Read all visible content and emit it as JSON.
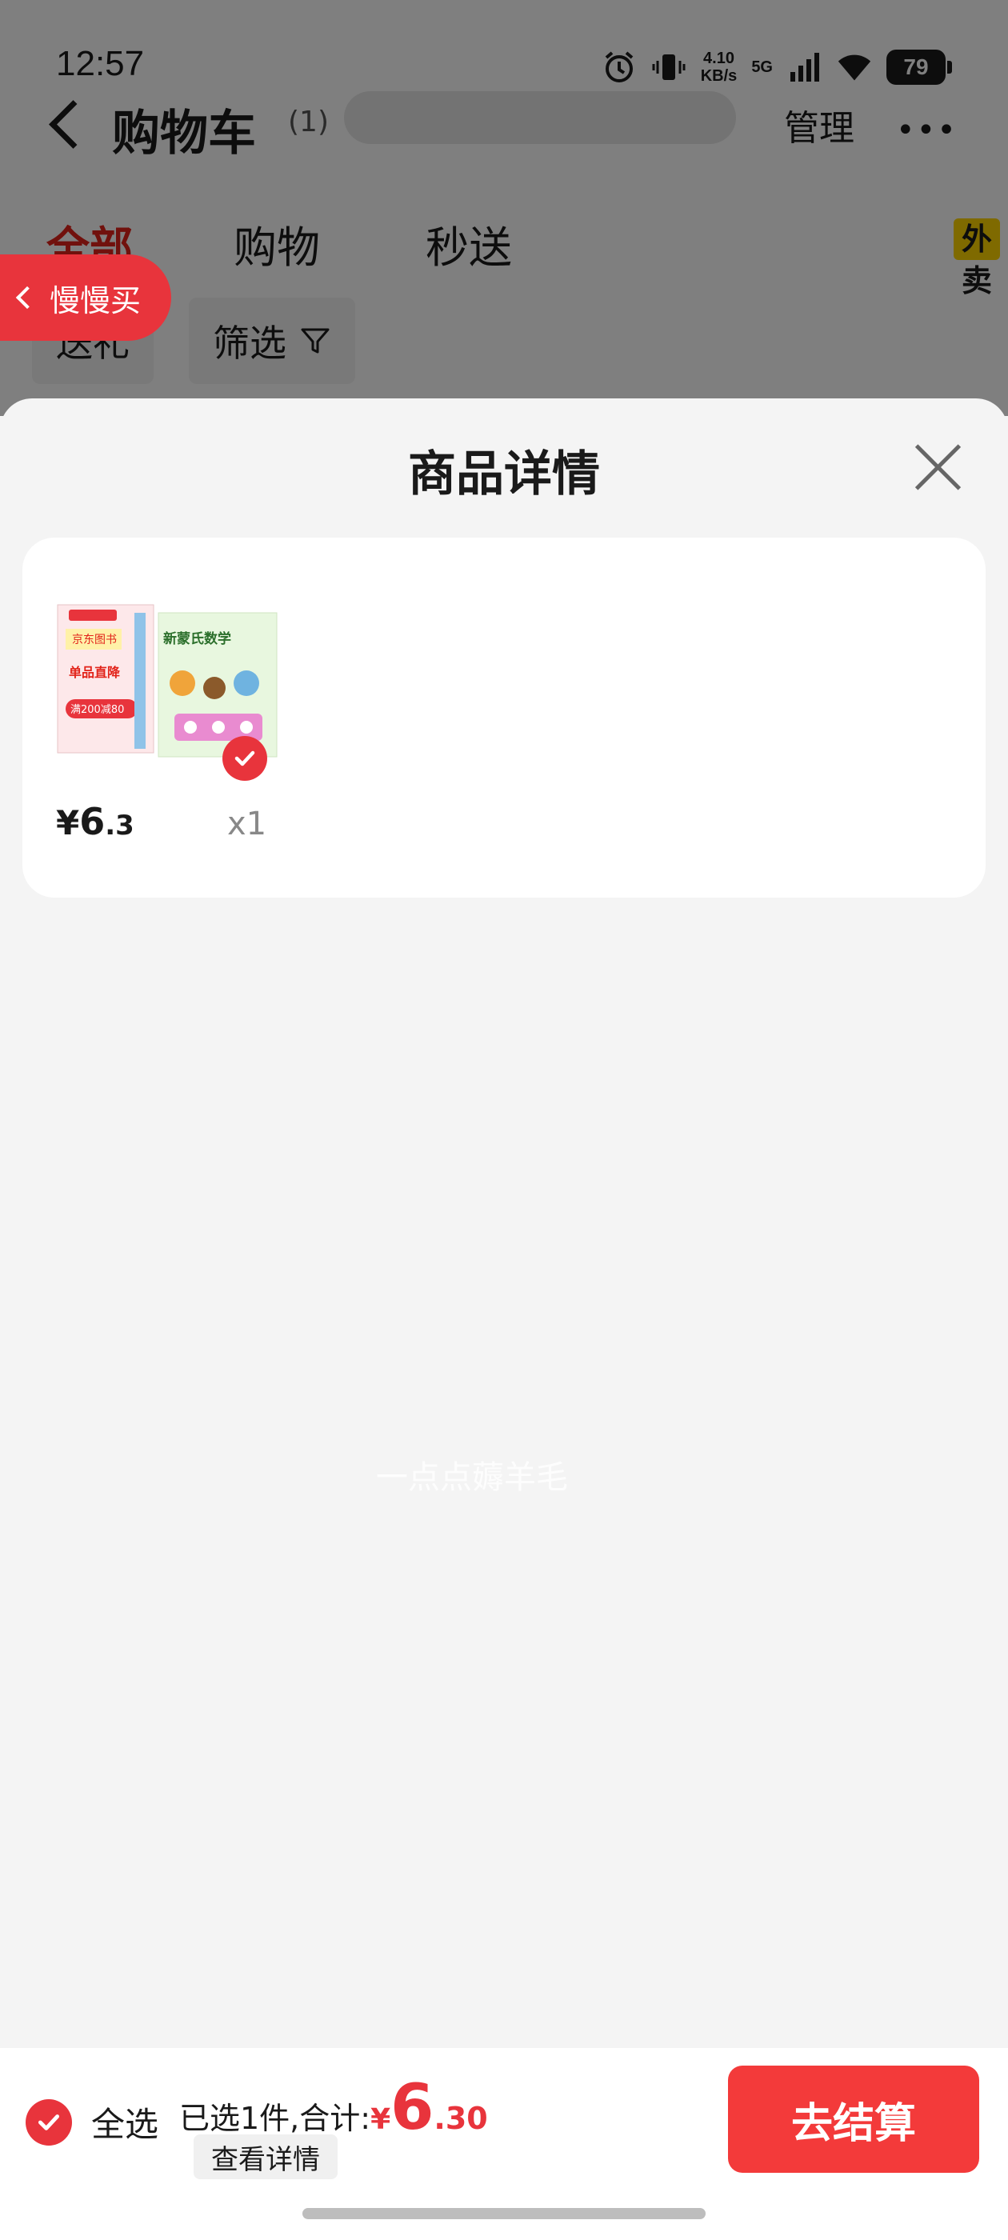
{
  "status_bar": {
    "time": "12:57",
    "net_speed_value": "4.10",
    "net_speed_unit": "KB/s",
    "network": "5G",
    "battery": "79",
    "icons": [
      "alarm-icon",
      "vibrate-icon",
      "signal-icon",
      "wifi-icon",
      "battery-icon"
    ]
  },
  "background_page": {
    "title": "购物车",
    "count": "(1)",
    "manage_label": "管理",
    "tabs": [
      {
        "label": "全部"
      },
      {
        "label": "购物"
      },
      {
        "label": "秒送"
      }
    ],
    "takeaway_badge": "外卖",
    "filters": [
      {
        "label": "送礼"
      },
      {
        "label": "筛选"
      }
    ],
    "slow_buy_label": "慢慢买"
  },
  "modal": {
    "title": "商品详情",
    "product": {
      "price_currency": "¥",
      "price_int": "6",
      "price_dec": ".3",
      "quantity": "x1",
      "image_text": {
        "brand": "京东图书",
        "promo": "单品直降",
        "deal": "满200减80",
        "book_title": "新蒙氏数学"
      }
    },
    "watermark": "一点点薅羊毛"
  },
  "bottom_bar": {
    "select_all_label": "全选",
    "summary_prefix": "已选1件,合计:",
    "total_currency": "¥",
    "total_int": "6",
    "total_dec": ".30",
    "details_label": "查看详情",
    "checkout_label": "去结算"
  },
  "colors": {
    "accent_red": "#e8343c",
    "checkout_red": "#f33a3a",
    "badge_yellow": "#ffd400"
  }
}
